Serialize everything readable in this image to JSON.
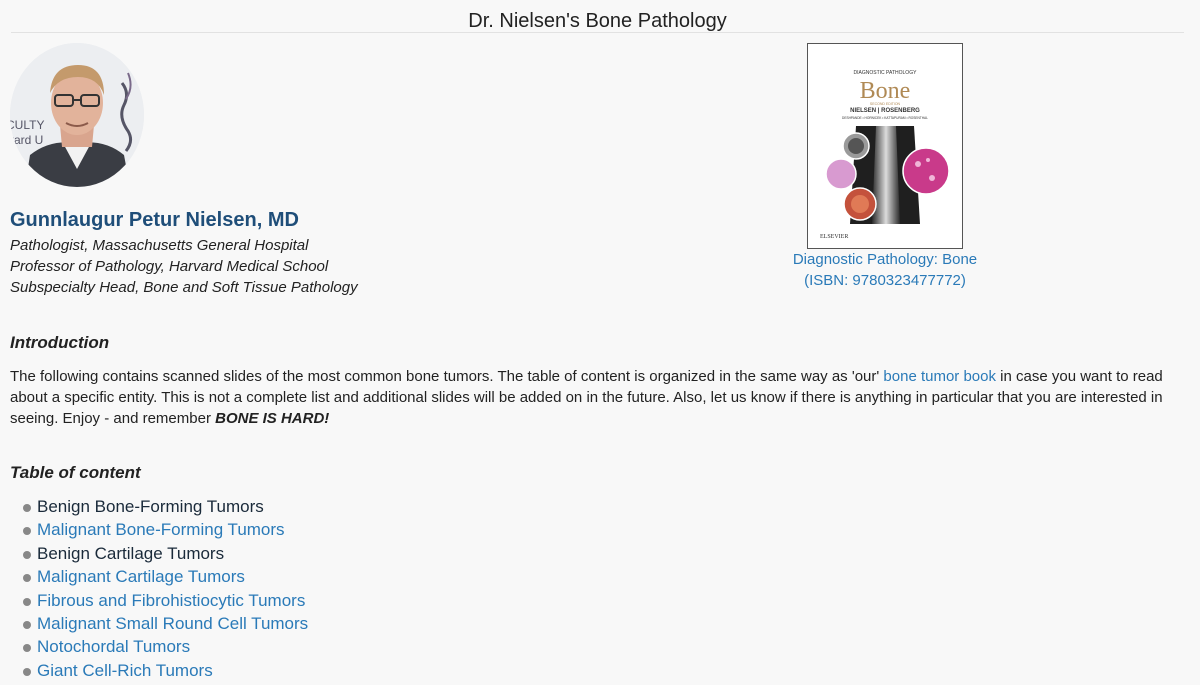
{
  "header": {
    "title": "Dr. Nielsen's Bone Pathology"
  },
  "author": {
    "name": "Gunnlaugur Petur Nielsen, MD",
    "positions": [
      "Pathologist, Massachusetts General Hospital",
      "Professor of Pathology, Harvard Medical School",
      "Subspecialty Head, Bone and Soft Tissue Pathology"
    ],
    "backdrop_text": [
      "CULTY",
      "vard U"
    ]
  },
  "book": {
    "cover_series": "DIAGNOSTIC PATHOLOGY",
    "cover_title": "Bone",
    "cover_edition": "SECOND EDITION",
    "cover_authors": "NIELSEN | ROSENBERG",
    "cover_coauthors": "DESHPANDE • HORNICEK • KATTAPURAM • ROSENTHAL",
    "cover_publisher": "ELSEVIER",
    "caption_title": "Diagnostic Pathology: Bone",
    "caption_isbn": "(ISBN: 9780323477772)"
  },
  "introduction": {
    "heading": "Introduction",
    "text_before_link": "The following contains scanned slides of the most common bone tumors. The table of content is organized in the same way as 'our' ",
    "link_text": "bone tumor book",
    "text_after_link": " in case you want to read about a specific entity. This is not a complete list and additional slides will be added on in the future. Also, let us know if there is anything in particular that you are interested in seeing. Enjoy - and remember ",
    "emphasis": "BONE IS HARD!"
  },
  "toc": {
    "heading": "Table of content",
    "items": [
      {
        "label": "Benign Bone-Forming Tumors",
        "style": "plain"
      },
      {
        "label": "Malignant Bone-Forming Tumors",
        "style": "link"
      },
      {
        "label": "Benign Cartilage Tumors",
        "style": "plain"
      },
      {
        "label": "Malignant Cartilage Tumors",
        "style": "link"
      },
      {
        "label": "Fibrous and Fibrohistiocytic Tumors",
        "style": "link"
      },
      {
        "label": "Malignant Small Round Cell Tumors",
        "style": "link"
      },
      {
        "label": "Notochordal Tumors",
        "style": "link"
      },
      {
        "label": "Giant Cell-Rich Tumors",
        "style": "link"
      }
    ]
  },
  "colors": {
    "background": "#f8f8f8",
    "link": "#2a7ab8",
    "author_name": "#1f4e79",
    "book_title": "#b08a55"
  }
}
